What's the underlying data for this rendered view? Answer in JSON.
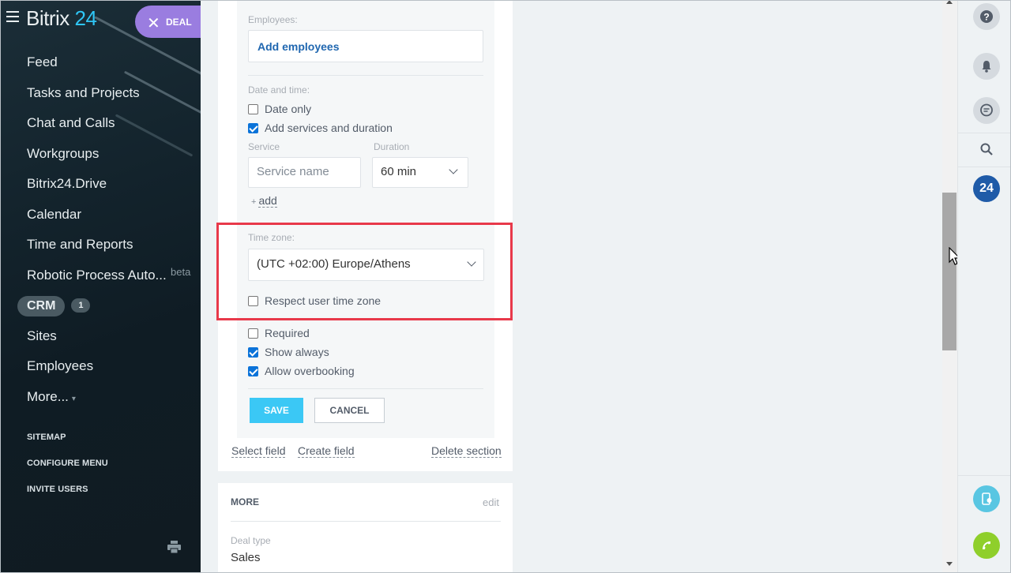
{
  "sidebar": {
    "logo_text": "Bitrix",
    "logo_num": "24",
    "deal_label": "DEAL",
    "menu": [
      {
        "label": "Feed"
      },
      {
        "label": "Tasks and Projects"
      },
      {
        "label": "Chat and Calls"
      },
      {
        "label": "Workgroups"
      },
      {
        "label": "Bitrix24.Drive"
      },
      {
        "label": "Calendar"
      },
      {
        "label": "Time and Reports"
      },
      {
        "label": "Robotic Process Auto...",
        "tag": "beta"
      }
    ],
    "crm_label": "CRM",
    "crm_count": "1",
    "menu2": [
      {
        "label": "Sites"
      },
      {
        "label": "Employees"
      }
    ],
    "more_label": "More...",
    "sitemap": "SITEMAP",
    "configure_menu": "CONFIGURE MENU",
    "invite_users": "INVITE USERS"
  },
  "form": {
    "employees_label": "Employees:",
    "add_employees": "Add employees",
    "date_time_label": "Date and time:",
    "date_only": "Date only",
    "date_only_checked": false,
    "add_services": "Add services and duration",
    "add_services_checked": true,
    "service_label": "Service",
    "duration_label": "Duration",
    "service_placeholder": "Service name",
    "duration_value": "60 min",
    "add_link": "add",
    "timezone_label": "Time zone:",
    "timezone_value": "(UTC +02:00) Europe/Athens",
    "respect_tz": "Respect user time zone",
    "respect_tz_checked": false,
    "required": "Required",
    "required_checked": false,
    "show_always": "Show always",
    "show_always_checked": true,
    "allow_overbooking": "Allow overbooking",
    "allow_overbooking_checked": true,
    "save": "SAVE",
    "cancel": "CANCEL"
  },
  "section_links": {
    "select_field": "Select field",
    "create_field": "Create field",
    "delete_section": "Delete section"
  },
  "more_section": {
    "title": "MORE",
    "edit": "edit",
    "deal_type_label": "Deal type",
    "deal_type_value": "Sales"
  },
  "right_panel": {
    "icons": [
      "help-icon",
      "bell-icon",
      "chat-icon",
      "search-icon",
      "bitrix24-icon",
      "phone-chat-icon",
      "call-icon"
    ],
    "b24_label": "24"
  },
  "colors": {
    "accent": "#3bc8f5",
    "highlight": "#e8394a",
    "deal_pill": "#9a7de0",
    "link": "#2067b0"
  }
}
